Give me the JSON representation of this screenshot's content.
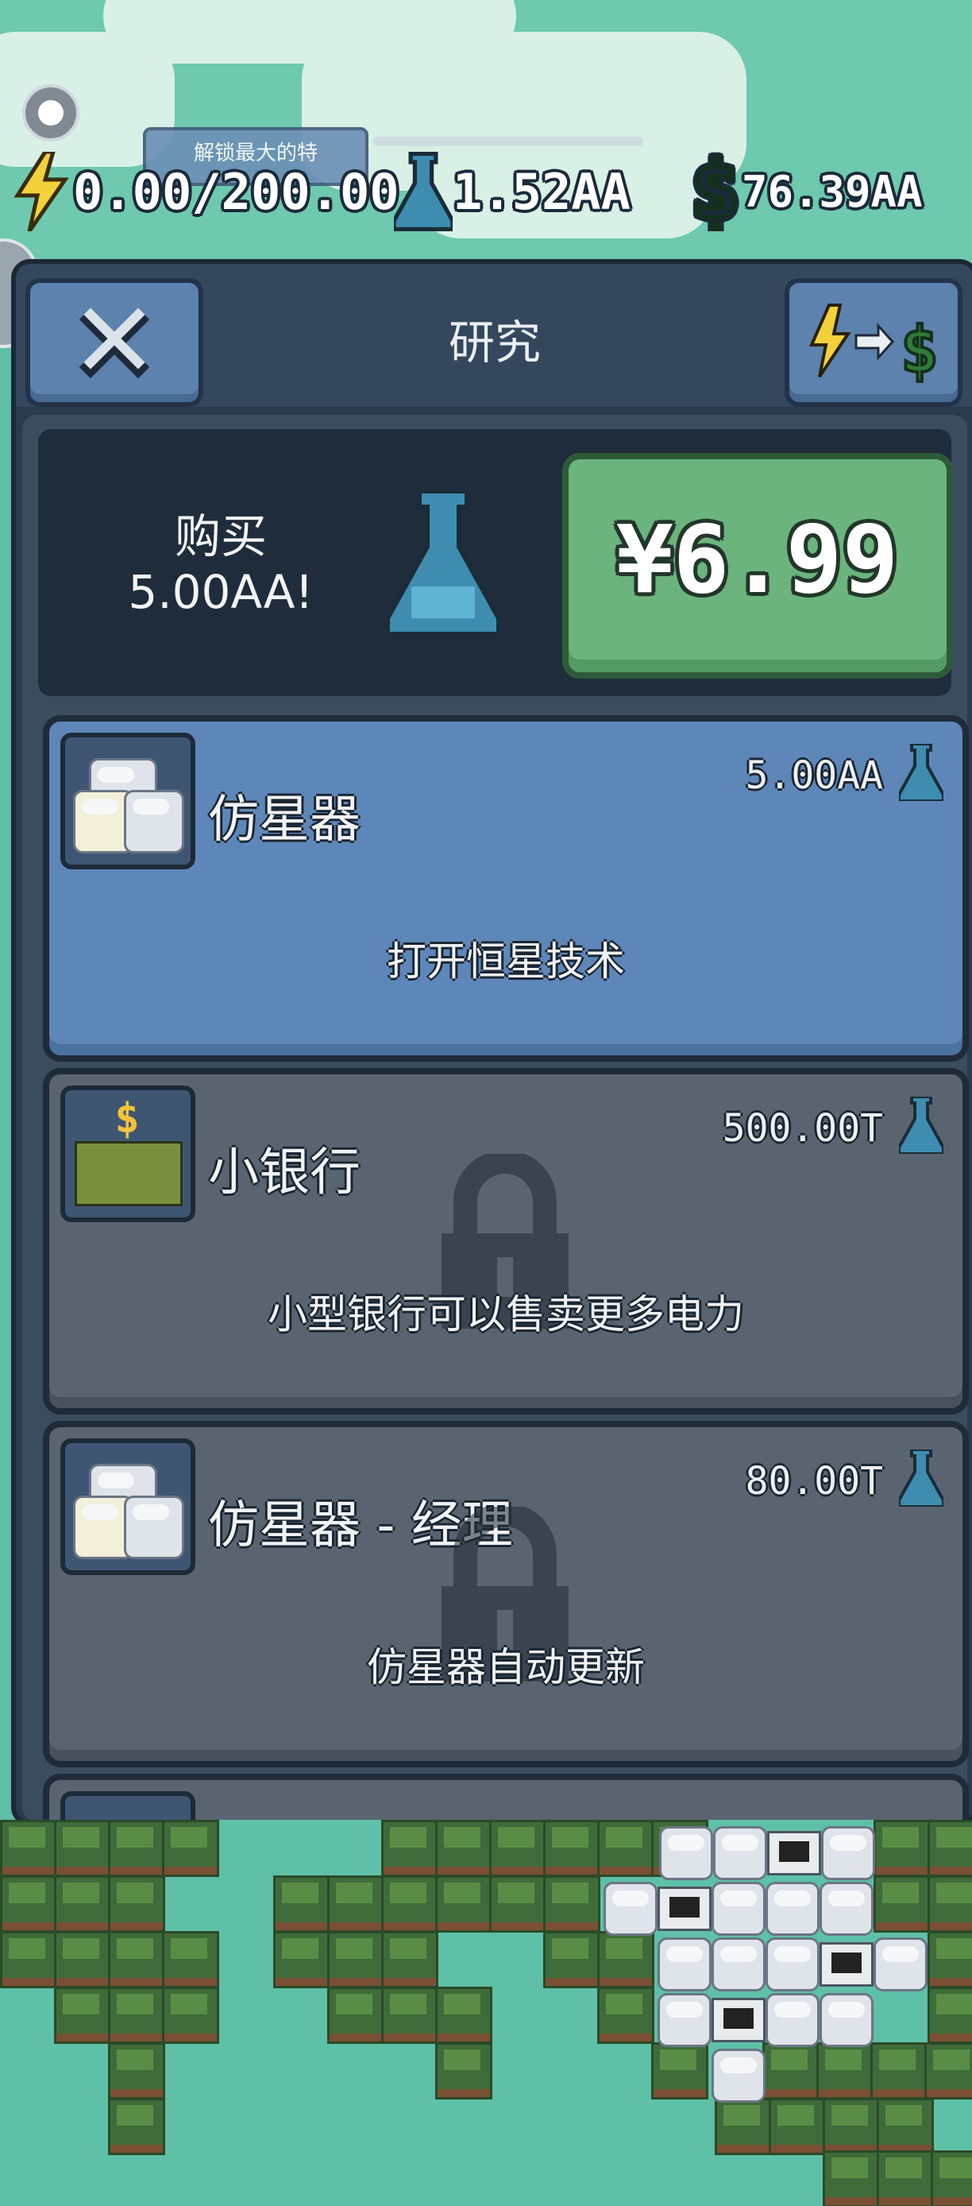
{
  "resources": {
    "energy": "0.00/200.00",
    "research": "1.52AA",
    "money": "76.39AA"
  },
  "tooltip": "解锁最大的特",
  "header": {
    "title": "研究",
    "close_icon": "close-icon",
    "convert_icon": "energy-to-money-icon"
  },
  "promo": {
    "label_line1": "购买",
    "label_line2": "5.00AA!",
    "price": "¥6.99"
  },
  "cards": [
    {
      "name": "仿星器",
      "cost": "5.00AA",
      "desc": "打开恒星技术",
      "state": "active",
      "icon": "stellarator-icon"
    },
    {
      "name": "小银行",
      "cost": "500.00T",
      "desc": "小型银行可以售卖更多电力",
      "state": "locked",
      "icon": "small-bank-icon"
    },
    {
      "name": "仿星器 - 经理",
      "cost": "80.00T",
      "desc": "仿星器自动更新",
      "state": "locked",
      "icon": "stellarator-icon"
    }
  ],
  "colors": {
    "panel": "#2b3a4c",
    "active_card": "#5d87b8",
    "locked_card": "#5a6470",
    "buy_button": "#6bb47d",
    "energy": "#f2d13a",
    "research": "#3e8db0",
    "money": "#2f7a3a"
  }
}
